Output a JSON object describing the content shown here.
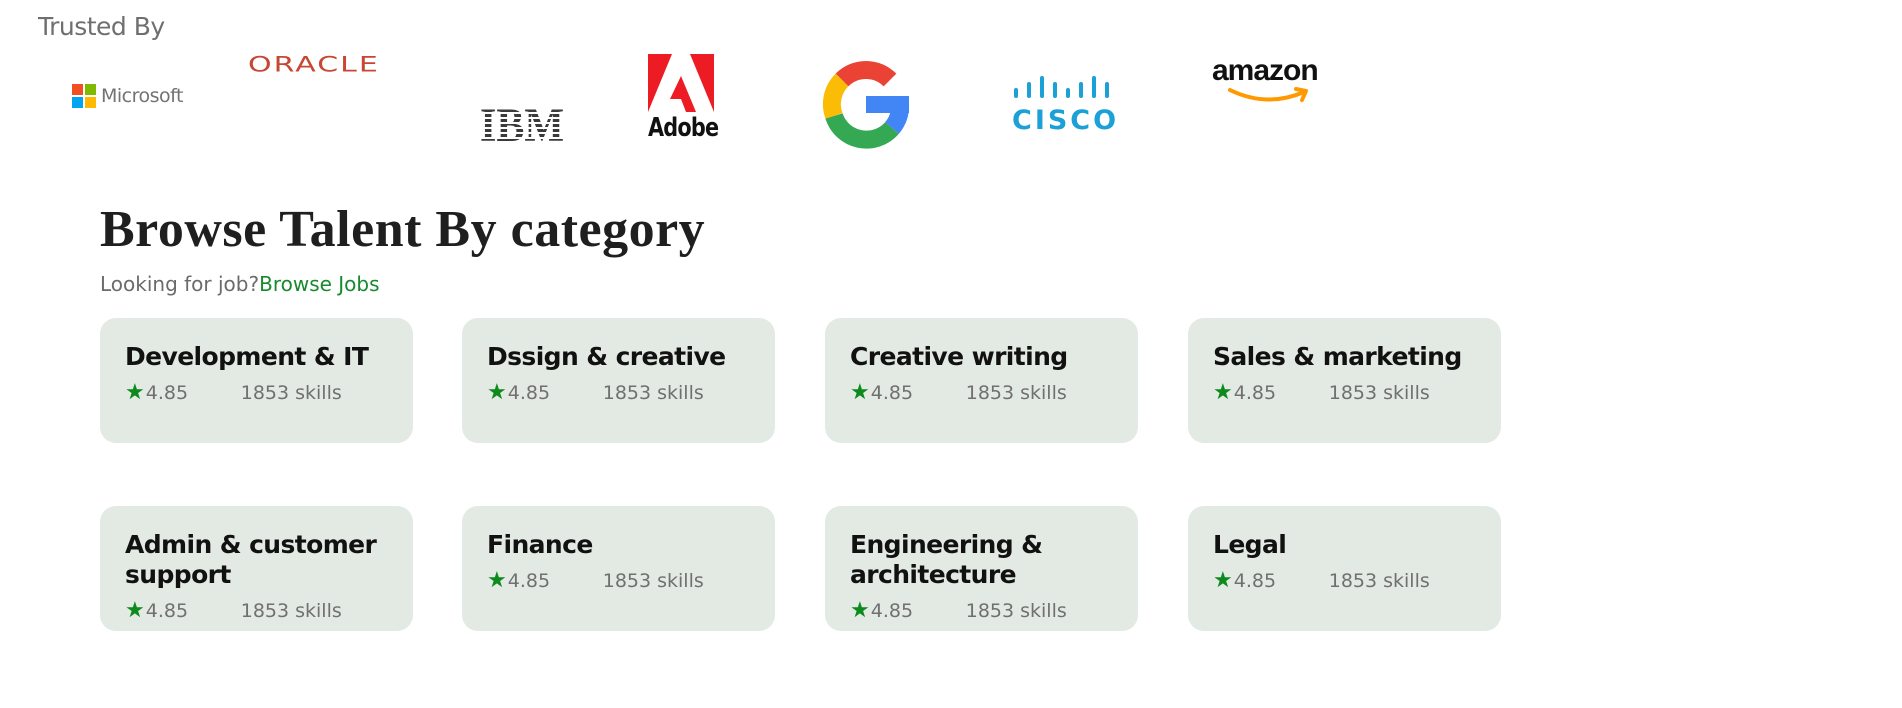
{
  "trusted": {
    "title": "Trusted By",
    "logos": {
      "microsoft": "Microsoft",
      "oracle": "ORACLE",
      "ibm": "IBM",
      "adobe": "Adobe",
      "google": "G",
      "cisco": "CISCO",
      "amazon": "amazon"
    }
  },
  "browse": {
    "title": "Browse Talent By category",
    "prompt": "Looking for job?",
    "link": "Browse Jobs"
  },
  "categories": [
    {
      "name": "Development & IT",
      "rating": "4.85",
      "skills": "1853 skills"
    },
    {
      "name": "Dssign & creative",
      "rating": "4.85",
      "skills": "1853 skills"
    },
    {
      "name": "Creative writing",
      "rating": "4.85",
      "skills": "1853 skills"
    },
    {
      "name": "Sales & marketing",
      "rating": "4.85",
      "skills": "1853 skills"
    },
    {
      "name": "Admin & customer support",
      "rating": "4.85",
      "skills": "1853 skills"
    },
    {
      "name": "Finance",
      "rating": "4.85",
      "skills": "1853 skills"
    },
    {
      "name": "Engineering & architecture",
      "rating": "4.85",
      "skills": "1853 skills"
    },
    {
      "name": "Legal",
      "rating": "4.85",
      "skills": "1853 skills"
    }
  ],
  "colors": {
    "accent_green": "#178a2e",
    "star_green": "#0c8a1c",
    "card_bg": "#e3e9e3"
  },
  "icons": {
    "rating": "star-icon"
  }
}
